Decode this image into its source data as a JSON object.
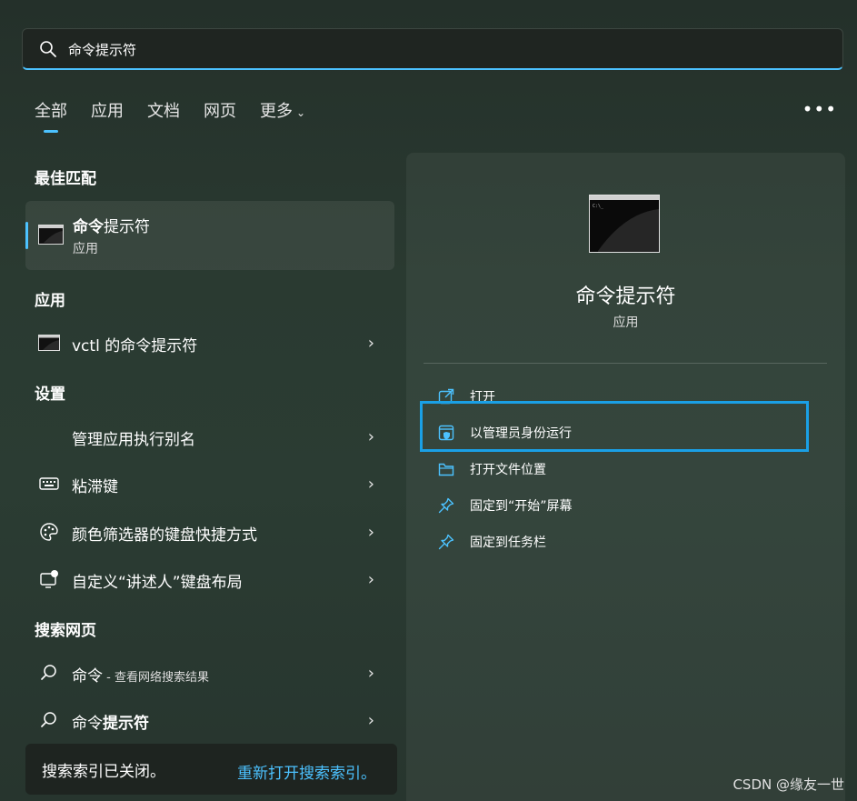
{
  "search": {
    "value": "命令提示符",
    "placeholder": ""
  },
  "tabs": [
    {
      "label": "全部",
      "active": true
    },
    {
      "label": "应用"
    },
    {
      "label": "文档"
    },
    {
      "label": "网页"
    },
    {
      "label": "更多"
    }
  ],
  "more_options": "•••",
  "sections": {
    "best_match": "最佳匹配",
    "apps": "应用",
    "settings": "设置",
    "web": "搜索网页"
  },
  "best_match": {
    "name_bold": "命令",
    "name_rest": "提示符",
    "type": "应用"
  },
  "apps": [
    {
      "label": "vctl 的命令提示符"
    }
  ],
  "settings": [
    {
      "label": "管理应用执行别名"
    },
    {
      "label": "粘滞键"
    },
    {
      "label": "颜色筛选器的键盘快捷方式"
    },
    {
      "label": "自定义“讲述人”键盘布局"
    }
  ],
  "web": [
    {
      "label": "命令",
      "suffix": " - 查看网络搜索结果"
    },
    {
      "label_prefix": "命令",
      "label_bold": "提示符"
    }
  ],
  "footer": {
    "message": "搜索索引已关闭。",
    "link": "重新打开搜索索引。"
  },
  "detail": {
    "title": "命令提示符",
    "subtitle": "应用",
    "actions": [
      {
        "label": "打开"
      },
      {
        "label": "以管理员身份运行"
      },
      {
        "label": "打开文件位置"
      },
      {
        "label": "固定到“开始”屏幕"
      },
      {
        "label": "固定到任务栏"
      }
    ]
  },
  "watermark": "CSDN @缘友一世",
  "colors": {
    "accent": "#4cc2ff",
    "highlight": "#1aa0e6"
  }
}
